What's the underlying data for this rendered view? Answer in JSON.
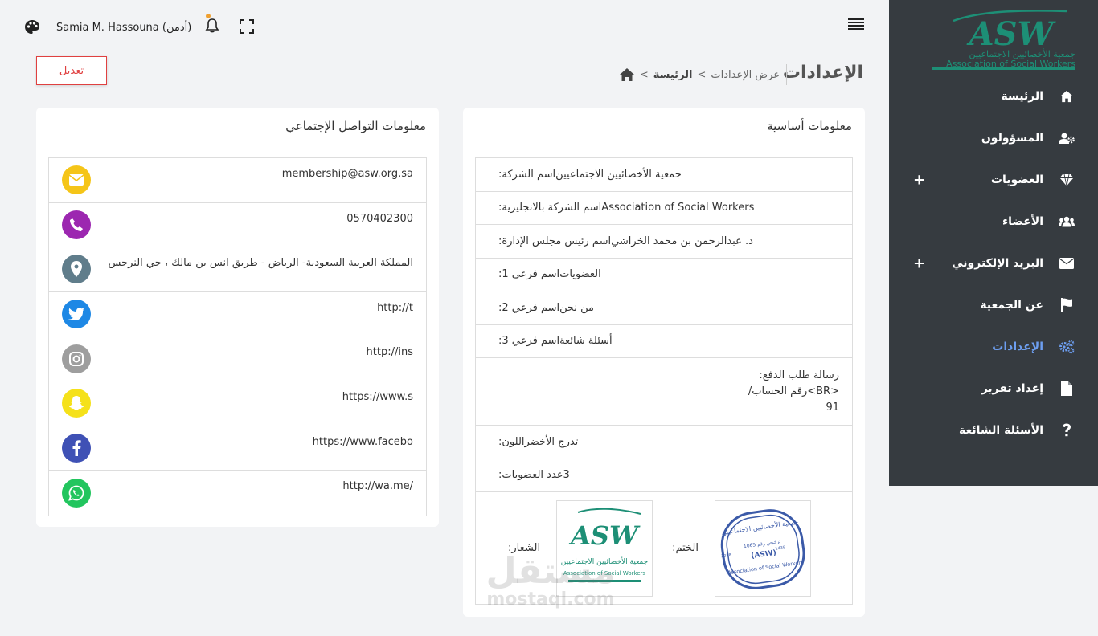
{
  "topbar": {
    "username": "Samia M. Hassouna (أدمن)"
  },
  "sidebar": {
    "logo": {
      "brand": "ASW",
      "arabic_name": "جمعية الأخصائيين الاجتماعيين",
      "english_name": "Association of Social Workers"
    },
    "items": [
      {
        "label": "الرئيسة",
        "icon": "home-icon"
      },
      {
        "label": "المسؤولون",
        "icon": "users-cog-icon"
      },
      {
        "label": "العضويات",
        "icon": "diamond-icon"
      },
      {
        "label": "الأعضاء",
        "icon": "users-icon"
      },
      {
        "label": "البريد الإلكتروني",
        "icon": "envelope-icon"
      },
      {
        "label": "عن الجمعية",
        "icon": "flag-icon"
      },
      {
        "label": "الإعدادات",
        "icon": "cogs-icon"
      },
      {
        "label": "إعداد تقرير",
        "icon": "file-icon"
      },
      {
        "label": "الأسئلة الشائعة",
        "icon": "question-icon"
      }
    ],
    "plus": "+",
    "accent": "#6d9ef0",
    "bg": "#363b40"
  },
  "header": {
    "title": "الإعدادات",
    "breadcrumb_home": "الرئيسة",
    "breadcrumb_sep": ">",
    "breadcrumb_current": "عرض الإعدادات"
  },
  "actions": {
    "edit_label": "تعديل"
  },
  "basic_info": {
    "title": "معلومات أساسية",
    "rows": [
      {
        "label": "اسم الشركة:",
        "value": "جمعية الأخصائيين الاجتماعيين"
      },
      {
        "label": "اسم الشركة بالانجليزية:",
        "value": "Association of Social Workers"
      },
      {
        "label": "اسم رئيس مجلس الإدارة:",
        "value": "د. عبدالرحمن بن محمد الخراشي"
      },
      {
        "label": "اسم فرعي 1:",
        "value": "العضويات"
      },
      {
        "label": "اسم فرعي 2:",
        "value": "من نحن"
      },
      {
        "label": "اسم فرعي 3:",
        "value": "أسئلة شائعة"
      }
    ],
    "payment": {
      "label": "رسالة طلب الدفع:",
      "line1": "<BR>رقم الحساب/",
      "line2": "91"
    },
    "color_label": "اللون:",
    "color_value": "تدرج الأخضر",
    "membership_count_label": "عدد العضويات:",
    "membership_count_value": "3",
    "logo_label": "الشعار:",
    "stamp_label": "الختم:",
    "stamp": {
      "top": "جمعية الأخصائيين الاجتماعيين",
      "middle": "(ASW)",
      "bottom": "Association of Social Workers",
      "reg": "ترخيص رقم 1065",
      "year_left": "2018",
      "year_right": "1439"
    }
  },
  "social_info": {
    "title": "معلومات التواصل الإجتماعي",
    "rows": [
      {
        "value": "membership@asw.org.sa",
        "icon": "envelope-icon",
        "color": "#f5c518"
      },
      {
        "value": "0570402300",
        "icon": "phone-icon",
        "color": "#9c27b0"
      },
      {
        "value": "المملكة العربية السعودية- الرياض - طريق انس بن مالك ، حي النرجس",
        "icon": "map-marker-icon",
        "color": "#607d8b"
      },
      {
        "value": "http://t",
        "icon": "twitter-icon",
        "color": "#1e88e5"
      },
      {
        "value": "http://ins",
        "icon": "instagram-icon",
        "color": "#9e9e9e"
      },
      {
        "value": "https://www.s",
        "icon": "snapchat-icon",
        "color": "#f5e11a"
      },
      {
        "value": "https://www.facebo",
        "icon": "facebook-icon",
        "color": "#3f51b5"
      },
      {
        "value": "http://wa.me/",
        "icon": "whatsapp-icon",
        "color": "#22c55e"
      }
    ]
  },
  "watermark": {
    "arabic": "مستقل",
    "latin": "mostaql.com"
  }
}
